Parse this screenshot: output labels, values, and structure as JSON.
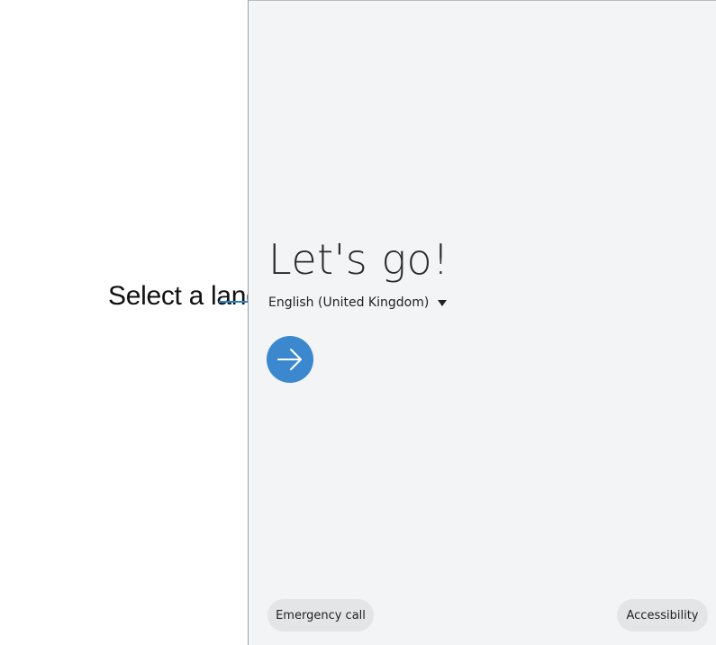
{
  "callout": {
    "text": "Select a language."
  },
  "screen": {
    "title": "Let's go!",
    "language": "English (United Kingdom)",
    "next_icon": "arrow-right-icon",
    "dropdown_icon": "triangle-down-icon",
    "emergency_call_label": "Emergency call",
    "accessibility_label": "Accessibility"
  },
  "colors": {
    "accent": "#3c88cf",
    "callout_line": "#2a83c6",
    "screen_background": "#f2f4f5",
    "pill_background": "#e3e5e6"
  }
}
